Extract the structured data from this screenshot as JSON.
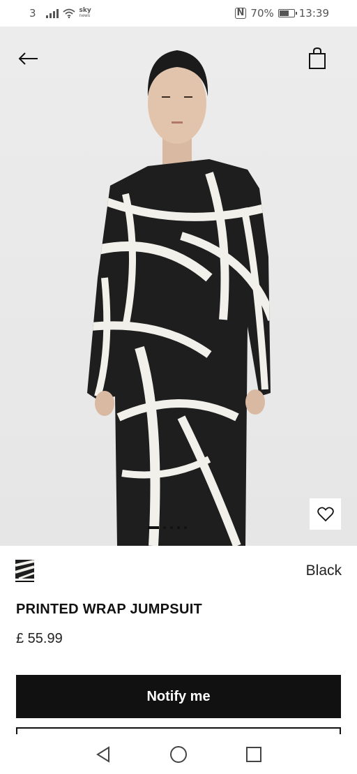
{
  "status_bar": {
    "sim_label": "3",
    "carrier_logo_top": "sky",
    "carrier_logo_bottom": "news",
    "battery_percent": "70%",
    "battery_level": 0.7,
    "time": "13:39",
    "icons": [
      "signal-icon",
      "wifi-icon",
      "nfc-icon",
      "battery-icon"
    ]
  },
  "header": {
    "back_icon": "arrow-left-icon",
    "bag_icon": "shopping-bag-icon"
  },
  "gallery": {
    "favorite_icon": "heart-icon",
    "image_count": 5,
    "active_index": 0
  },
  "product": {
    "color_name": "Black",
    "title": "PRINTED WRAP JUMPSUIT",
    "price": "£ 55.99",
    "notify_label": "Notify me"
  },
  "nav_bar": {
    "icons": [
      "back-triangle-icon",
      "home-circle-icon",
      "recents-square-icon"
    ]
  },
  "colors": {
    "button_bg": "#111111",
    "button_text": "#ffffff",
    "hero_bg": "#e9e9e9"
  }
}
